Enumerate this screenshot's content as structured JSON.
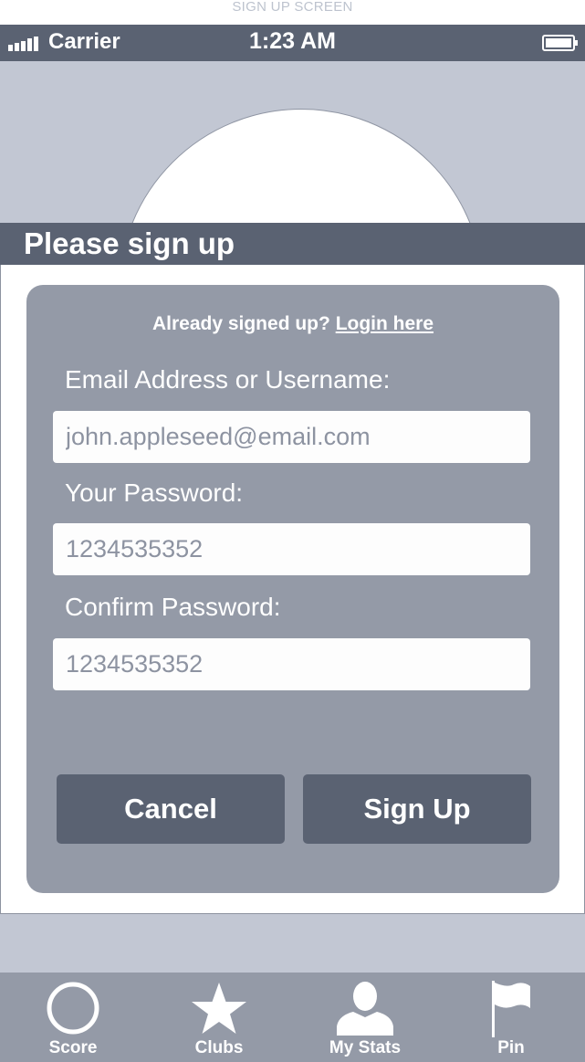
{
  "caption": "SIGN UP SCREEN",
  "status_bar": {
    "carrier": "Carrier",
    "time": "1:23 AM",
    "signal_icon": "signal-bars-icon",
    "battery_icon": "battery-icon"
  },
  "header": {
    "title": "Please sign up"
  },
  "form": {
    "already_prefix": "Already signed up?",
    "login_link": "Login here",
    "email_label": "Email Address or Username:",
    "email_placeholder": "john.appleseed@email.com",
    "password_label": "Your Password:",
    "password_placeholder": "1234535352",
    "confirm_label": "Confirm Password:",
    "confirm_placeholder": "1234535352",
    "cancel_label": "Cancel",
    "signup_label": "Sign Up"
  },
  "tabbar": {
    "items": [
      {
        "label": "Score",
        "icon": "circle-icon"
      },
      {
        "label": "Clubs",
        "icon": "star-icon"
      },
      {
        "label": "My Stats",
        "icon": "person-icon"
      },
      {
        "label": "Pin",
        "icon": "flag-icon"
      }
    ]
  },
  "colors": {
    "dark_bar": "#5a6272",
    "card": "#949aa7",
    "light_bg": "#c2c7d3"
  }
}
